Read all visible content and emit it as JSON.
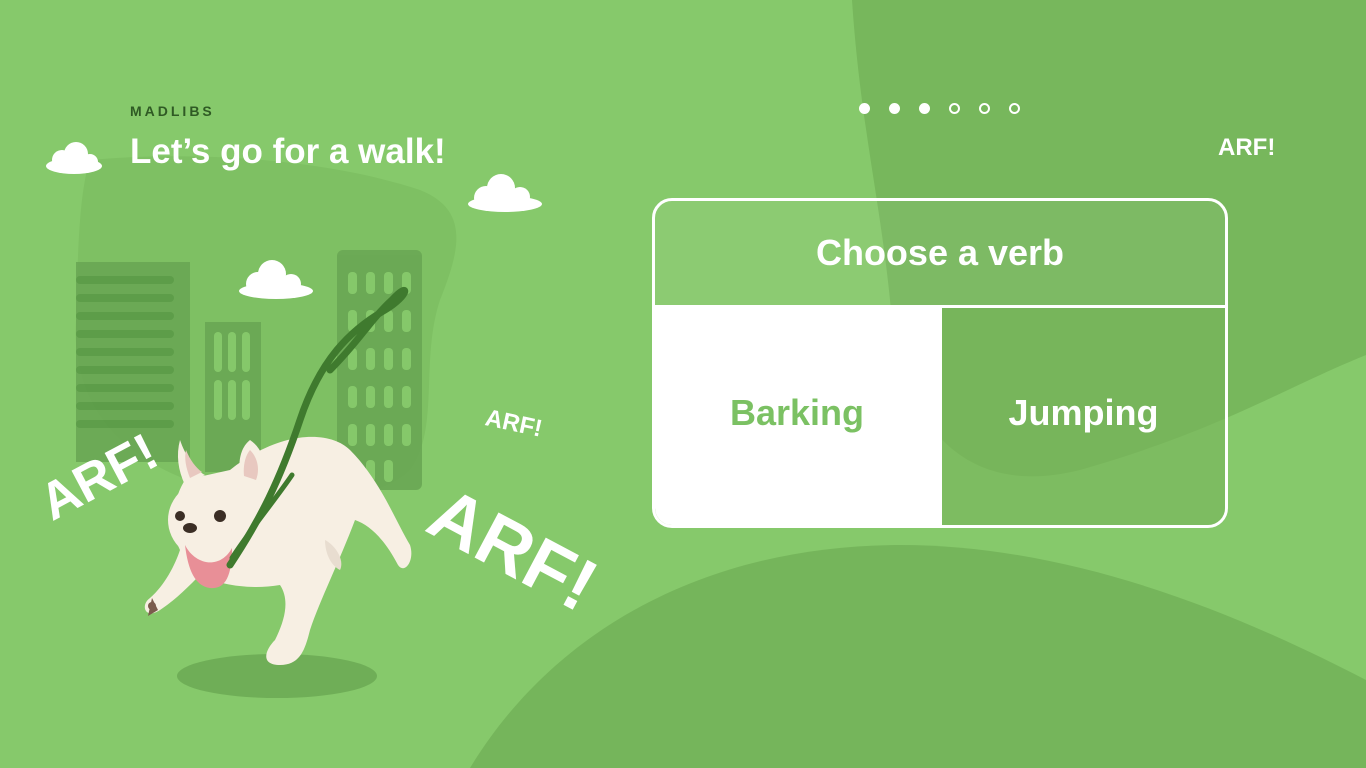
{
  "header": {
    "eyebrow": "MADLIBS",
    "title": "Let’s go for a walk!"
  },
  "progress": {
    "total_steps": 6,
    "completed_steps": 3
  },
  "question": {
    "prompt": "Choose a verb",
    "options": [
      {
        "label": "Barking",
        "state": "selected"
      },
      {
        "label": "Jumping",
        "state": "unselected"
      }
    ]
  },
  "decorations": {
    "arf_labels": [
      "ARF!",
      "ARF!",
      "ARF!",
      "ARF!"
    ]
  },
  "colors": {
    "background": "#86c96b",
    "dark_green": "#75b55b",
    "accent_text": "#7bc163",
    "white": "#ffffff"
  },
  "icons": [
    "cloud-icon",
    "dog-illustration",
    "building-illustration"
  ]
}
